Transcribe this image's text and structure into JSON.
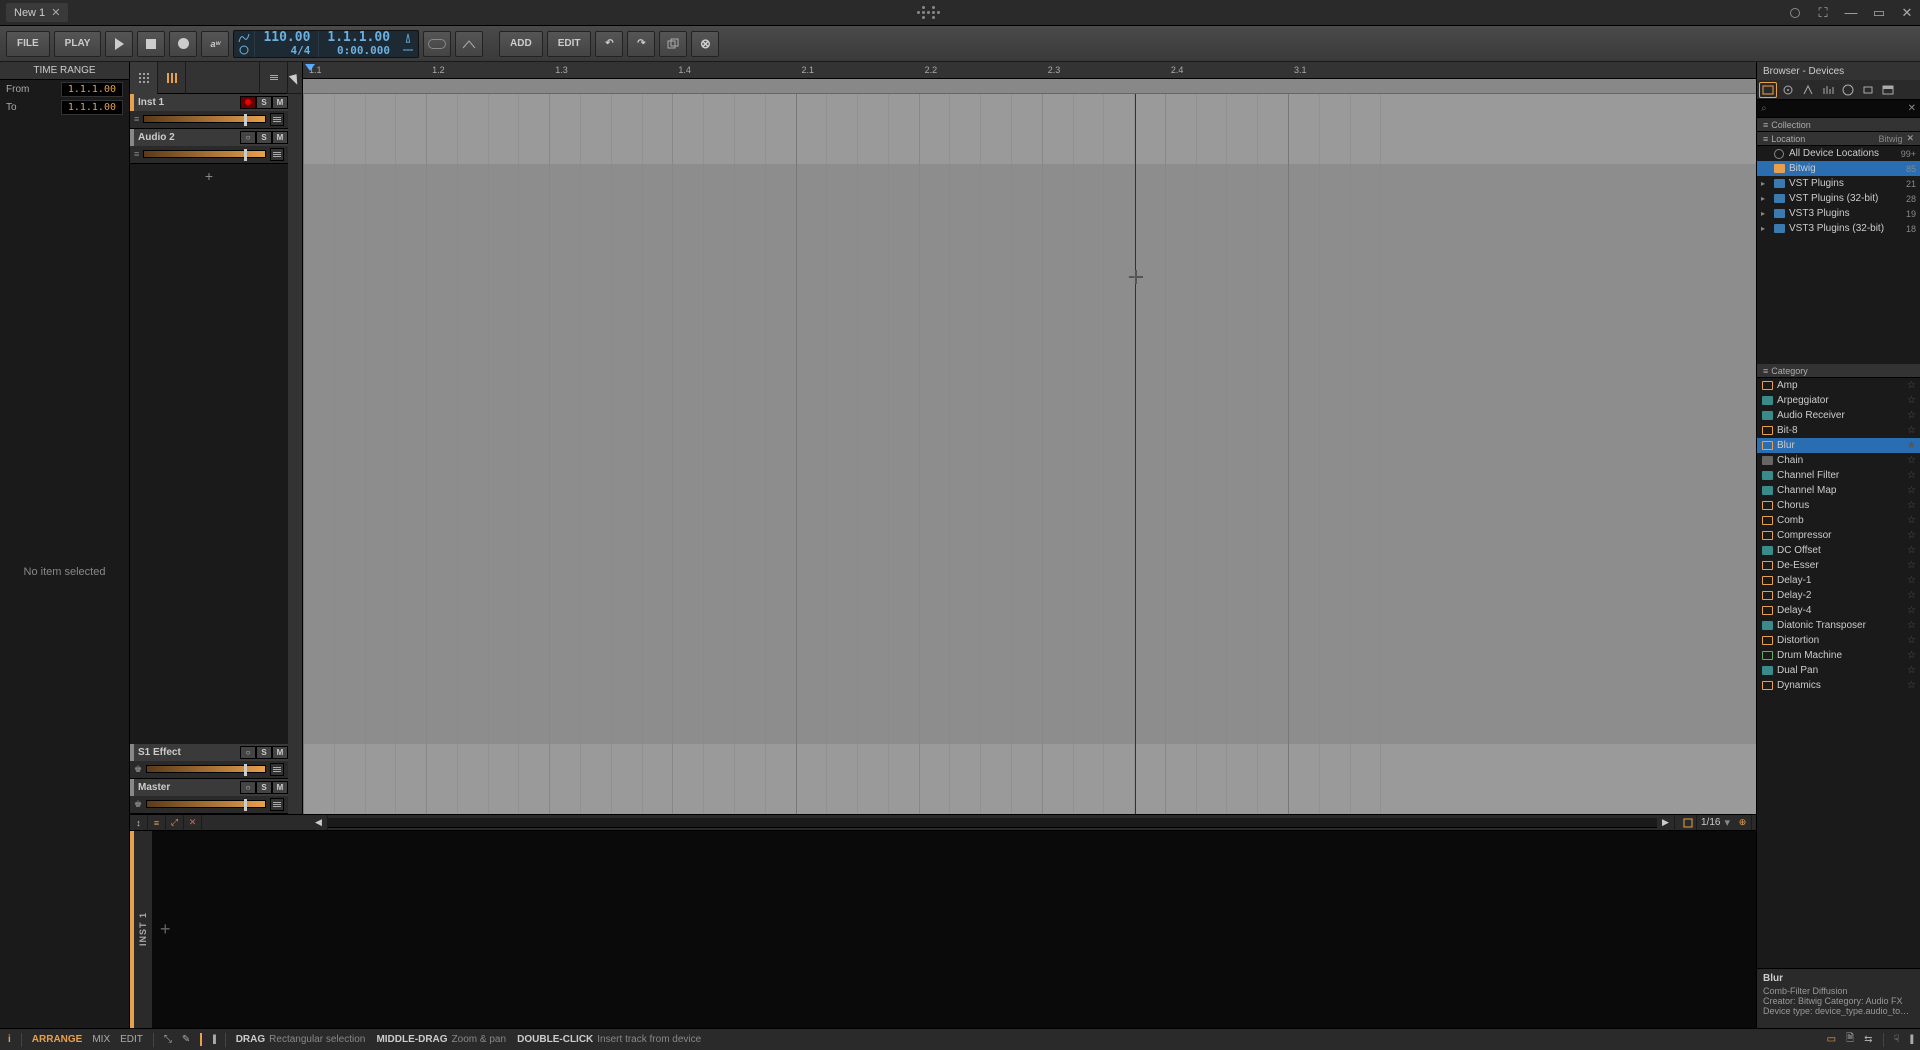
{
  "titlebar": {
    "tab_name": "New 1"
  },
  "transport": {
    "file": "FILE",
    "play": "PLAY",
    "tempo": "110.00",
    "timesig": "4/4",
    "position_bars": "1.1.1.00",
    "position_time": "0:00.000",
    "loop_start": "0",
    "loop_end": "0",
    "add": "ADD",
    "edit": "EDIT"
  },
  "time_range": {
    "header": "TIME RANGE",
    "from_label": "From",
    "from_val": "1.1.1.00",
    "to_label": "To",
    "to_val": "1.1.1.00"
  },
  "inspector": {
    "empty": "No item selected"
  },
  "tracks": [
    {
      "name": "Inst 1",
      "color": "#e8a04c",
      "rec": true
    },
    {
      "name": "Audio 2",
      "color": "#888888",
      "rec": false
    }
  ],
  "master_tracks": [
    {
      "name": "S1 Effect",
      "color": "#888888"
    },
    {
      "name": "Master",
      "color": "#888888"
    }
  ],
  "ruler": [
    "1.1",
    "1.2",
    "1.3",
    "1.4",
    "2.1",
    "2.2",
    "2.3",
    "2.4",
    "3.1"
  ],
  "snap": "1/16",
  "device_panel": {
    "track": "INST 1"
  },
  "browser": {
    "title": "Browser - Devices",
    "search_placeholder": "",
    "collection_header": "Collection",
    "location_header": "Location",
    "location_vendor": "Bitwig",
    "locations": [
      {
        "label": "All Device Locations",
        "count": "99+",
        "radio": true
      },
      {
        "label": "Bitwig",
        "count": "85",
        "selected": true,
        "icon": "folder"
      },
      {
        "label": "VST Plugins",
        "count": "21",
        "expand": true,
        "icon": "blue"
      },
      {
        "label": "VST Plugins (32-bit)",
        "count": "28",
        "expand": true,
        "icon": "blue"
      },
      {
        "label": "VST3 Plugins",
        "count": "19",
        "expand": true,
        "icon": "blue"
      },
      {
        "label": "VST3 Plugins (32-bit)",
        "count": "18",
        "expand": true,
        "icon": "blue"
      }
    ],
    "category_header": "Category",
    "categories": [
      {
        "label": "Amp",
        "icon": "orange"
      },
      {
        "label": "Arpeggiator",
        "icon": "cyan"
      },
      {
        "label": "Audio Receiver",
        "icon": "cyan"
      },
      {
        "label": "Bit-8",
        "icon": "orange"
      },
      {
        "label": "Blur",
        "icon": "orange",
        "selected": true,
        "star": true
      },
      {
        "label": "Chain",
        "icon": "gray"
      },
      {
        "label": "Channel Filter",
        "icon": "cyan"
      },
      {
        "label": "Channel Map",
        "icon": "cyan"
      },
      {
        "label": "Chorus",
        "icon": "orange"
      },
      {
        "label": "Comb",
        "icon": "orange"
      },
      {
        "label": "Compressor",
        "icon": "orange"
      },
      {
        "label": "DC Offset",
        "icon": "cyan"
      },
      {
        "label": "De-Esser",
        "icon": "orange"
      },
      {
        "label": "Delay-1",
        "icon": "orange"
      },
      {
        "label": "Delay-2",
        "icon": "orange"
      },
      {
        "label": "Delay-4",
        "icon": "orange"
      },
      {
        "label": "Diatonic Transposer",
        "icon": "cyan"
      },
      {
        "label": "Distortion",
        "icon": "orange"
      },
      {
        "label": "Drum Machine",
        "icon": "green"
      },
      {
        "label": "Dual Pan",
        "icon": "cyan"
      },
      {
        "label": "Dynamics",
        "icon": "orange"
      }
    ],
    "info": {
      "name": "Blur",
      "subtitle": "Comb-Filter Diffusion",
      "creator": "Creator: Bitwig    Category: Audio FX",
      "device_type": "Device type: device_type.audio_to_a..."
    }
  },
  "status": {
    "arrange": "ARRANGE",
    "mix": "MIX",
    "edit": "EDIT",
    "hints": [
      {
        "k": "DRAG",
        "d": "Rectangular selection"
      },
      {
        "k": "MIDDLE-DRAG",
        "d": "Zoom & pan"
      },
      {
        "k": "DOUBLE-CLICK",
        "d": "Insert track from device"
      }
    ]
  }
}
